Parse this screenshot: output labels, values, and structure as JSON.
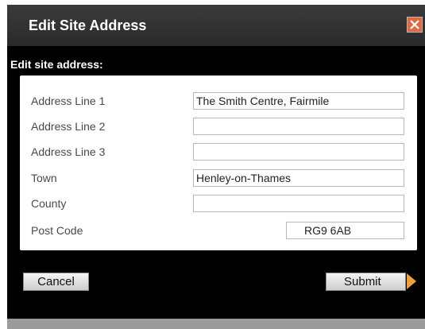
{
  "dialog": {
    "title": "Edit Site Address",
    "close_icon": "close-icon",
    "colors": {
      "background": "#000000",
      "close_button": "#e06a40",
      "submit_arrow": "#f0a035"
    }
  },
  "form": {
    "heading": "Edit site address:",
    "fields": [
      {
        "label": "Address Line 1",
        "value": "The Smith Centre, Fairmile"
      },
      {
        "label": "Address Line 2",
        "value": ""
      },
      {
        "label": "Address Line 3",
        "value": ""
      },
      {
        "label": "Town",
        "value": "Henley-on-Thames"
      },
      {
        "label": "County",
        "value": ""
      },
      {
        "label": "Post Code",
        "value": "RG9 6AB"
      }
    ]
  },
  "actions": {
    "cancel_label": "Cancel",
    "submit_label": "Submit",
    "submit_icon": "arrow-right-icon"
  }
}
